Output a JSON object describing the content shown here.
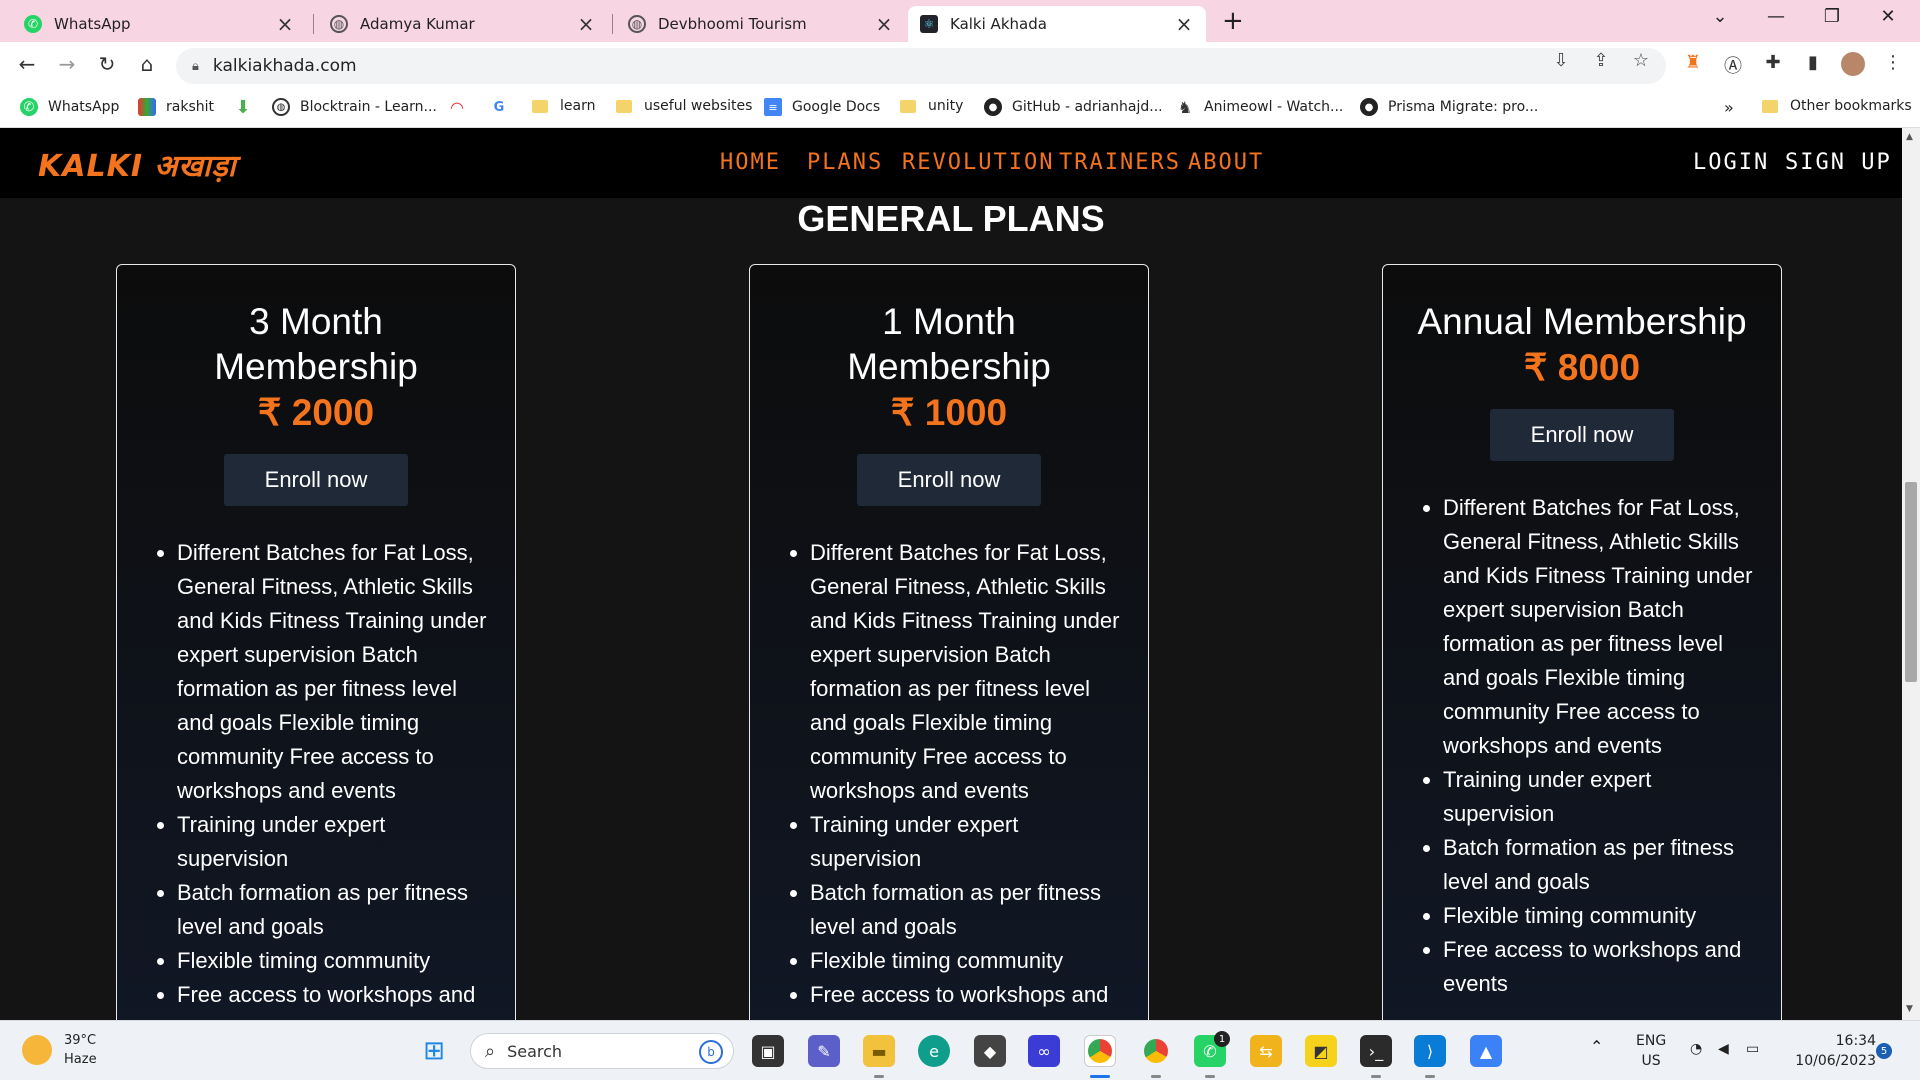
{
  "browser": {
    "tabs": [
      {
        "label": "WhatsApp",
        "icon": "whatsapp-icon"
      },
      {
        "label": "Adamya Kumar",
        "icon": "globe-icon"
      },
      {
        "label": "Devbhoomi Tourism",
        "icon": "globe-icon"
      },
      {
        "label": "Kalki Akhada",
        "icon": "react-icon",
        "active": true
      }
    ],
    "url": "kalkiakhada.com",
    "bookmarks": [
      {
        "label": "WhatsApp",
        "icon": "whatsapp-icon"
      },
      {
        "label": "rakshit",
        "icon": "colored-app-icon"
      },
      {
        "label": "",
        "icon": "download-arrow-icon"
      },
      {
        "label": "Blocktrain - Learn...",
        "icon": "globe-icon"
      },
      {
        "label": "",
        "icon": "gauge-icon"
      },
      {
        "label": "",
        "icon": "google-icon"
      },
      {
        "label": "learn",
        "icon": "folder-icon"
      },
      {
        "label": "useful websites",
        "icon": "folder-icon"
      },
      {
        "label": "Google Docs",
        "icon": "docs-icon"
      },
      {
        "label": "unity",
        "icon": "folder-icon"
      },
      {
        "label": "GitHub - adrianhajd...",
        "icon": "github-icon"
      },
      {
        "label": "Animeowl - Watch...",
        "icon": "owl-icon"
      },
      {
        "label": "Prisma Migrate: pro...",
        "icon": "github-icon"
      }
    ],
    "bookmarks_overflow": "»",
    "other_bookmarks": "Other bookmarks"
  },
  "site": {
    "logo_text": "KALKI अखाड़ा",
    "nav": [
      "HOME",
      "PLANS",
      "REVOLUTION",
      "TRAINERS",
      "ABOUT"
    ],
    "auth": [
      "LOGIN",
      "SIGN UP"
    ],
    "accent_color": "#f4741e"
  },
  "plans_section": {
    "title": "GENERAL PLANS",
    "cards": [
      {
        "title": "3 Month Membership",
        "price": "₹ 2000",
        "button": "Enroll now",
        "features": [
          "Different Batches for Fat Loss, General Fitness, Athletic Skills and Kids Fitness Training under expert supervision Batch formation as per fitness level and goals Flexible timing community Free access to workshops and events",
          "Training under expert supervision",
          "Batch formation as per fitness level and goals",
          "Flexible timing community",
          "Free access to workshops and events"
        ]
      },
      {
        "title": "1 Month Membership",
        "price": "₹ 1000",
        "button": "Enroll now",
        "features": [
          "Different Batches for Fat Loss, General Fitness, Athletic Skills and Kids Fitness Training under expert supervision Batch formation as per fitness level and goals Flexible timing community Free access to workshops and events",
          "Training under expert supervision",
          "Batch formation as per fitness level and goals",
          "Flexible timing community",
          "Free access to workshops and events"
        ]
      },
      {
        "title": "Annual Membership",
        "price": "₹ 8000",
        "button": "Enroll now",
        "features": [
          "Different Batches for Fat Loss, General Fitness, Athletic Skills and Kids Fitness Training under expert supervision Batch formation as per fitness level and goals Flexible timing community Free access to workshops and events",
          "Training under expert supervision",
          "Batch formation as per fitness level and goals",
          "Flexible timing community",
          "Free access to workshops and events"
        ]
      }
    ]
  },
  "taskbar": {
    "weather_temp": "39°C",
    "weather_desc": "Haze",
    "search_placeholder": "Search",
    "lang_line1": "ENG",
    "lang_line2": "US",
    "time": "16:34",
    "date": "10/06/2023",
    "notification_count": "5",
    "whatsapp_badge": "1"
  }
}
